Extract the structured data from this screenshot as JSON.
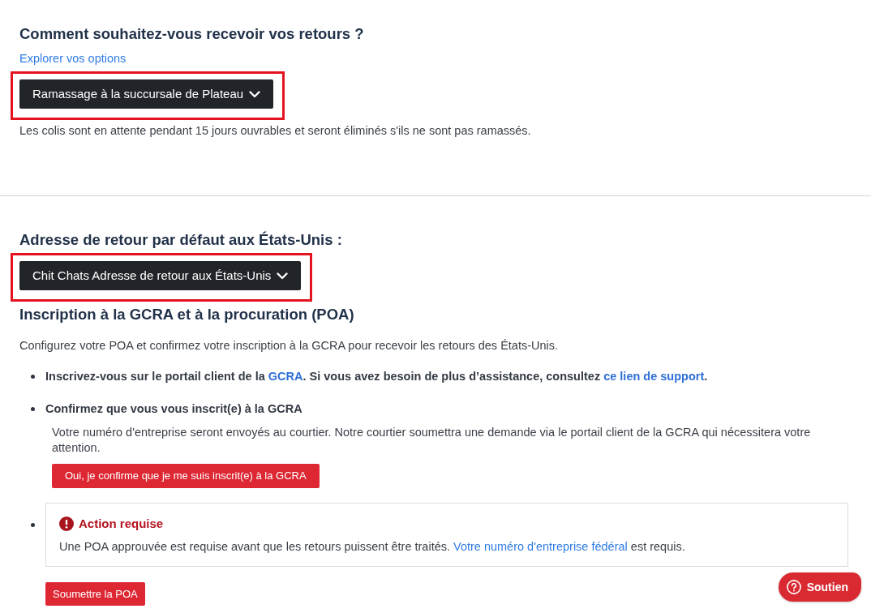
{
  "delivery": {
    "heading": "Comment souhaitez-vous recevoir vos retours ?",
    "link": "Explorer vos options",
    "dropdown": {
      "label": "Ramassage à la succursale de Plateau",
      "highlighted": true
    },
    "note": "Les colis sont en attente pendant 15 jours ouvrables et seront éliminés s'ils ne sont pas ramassés."
  },
  "us_return": {
    "heading": "Adresse de retour par défaut aux États-Unis :",
    "dropdown": {
      "label": "Chit Chats Adresse de retour aux États-Unis",
      "highlighted": true
    }
  },
  "registration": {
    "heading": "Inscription à la GCRA et à la procuration (POA)",
    "intro": "Configurez votre POA et confirmez votre inscription à la GCRA pour recevoir les retours des États-Unis.",
    "steps": [
      {
        "kind": "text",
        "segments": [
          {
            "text": "Inscrivez-vous sur le portail client de la ",
            "link": false
          },
          {
            "text": "GCRA",
            "link": true
          },
          {
            "text": ". Si vous avez besoin de plus d’assistance, consultez ",
            "link": false
          },
          {
            "text": "ce lien de support",
            "link": true
          },
          {
            "text": ".",
            "link": false
          }
        ]
      },
      {
        "kind": "confirm",
        "title": "Confirmez que vous vous inscrit(e) à la GCRA",
        "description": "Votre numéro d'entreprise seront envoyés au courtier. Notre courtier soumettra une demande via le portail client de la GCRA qui nécessitera votre attention.",
        "button": "Oui, je confirme que je me suis inscrit(e) à la GCRA"
      },
      {
        "kind": "alert",
        "title": "Action requise",
        "segments": [
          {
            "text": "Une POA approuvée est requise avant que les retours puissent être traités. ",
            "link": false
          },
          {
            "text": "Votre numéro d'entreprise fédéral",
            "link": true
          },
          {
            "text": " est requis.",
            "link": false
          }
        ]
      }
    ],
    "submit_button": "Soumettre la POA"
  },
  "help_button": "Soutien"
}
